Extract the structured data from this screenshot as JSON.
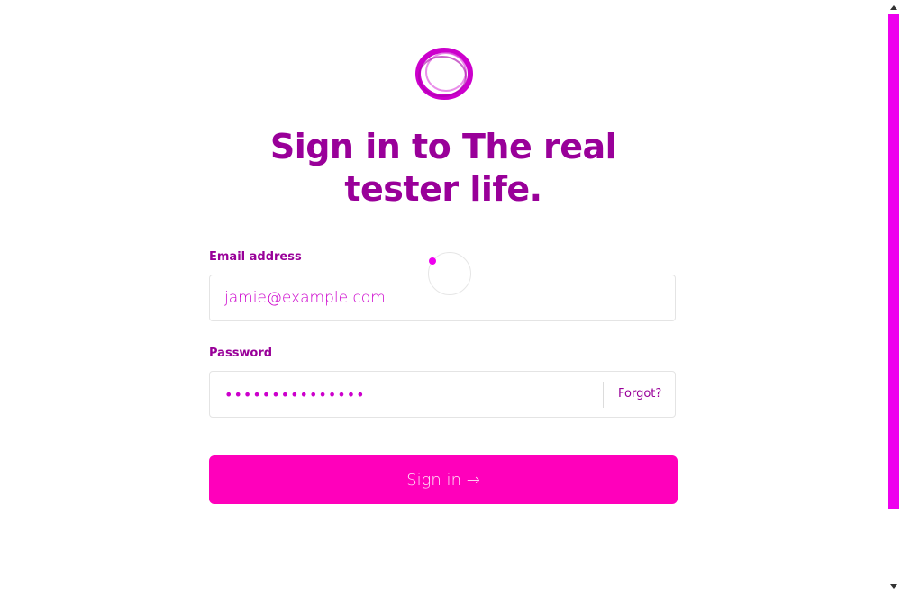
{
  "app": {
    "title": "Sign in to The real tester life."
  },
  "logo": {
    "icon": "ring-logo-icon",
    "color": "#cc00cc"
  },
  "form": {
    "email_label": "Email address",
    "email_value": "jamie@example.com",
    "password_label": "Password",
    "password_value": "•••••••••••••••",
    "forgot_label": "Forgot?",
    "submit_label": "Sign in →"
  },
  "colors": {
    "title": "#990099",
    "accent": "#ff00bb",
    "input_text": "#cc00cc",
    "scrollbar": "#ee00ee"
  }
}
